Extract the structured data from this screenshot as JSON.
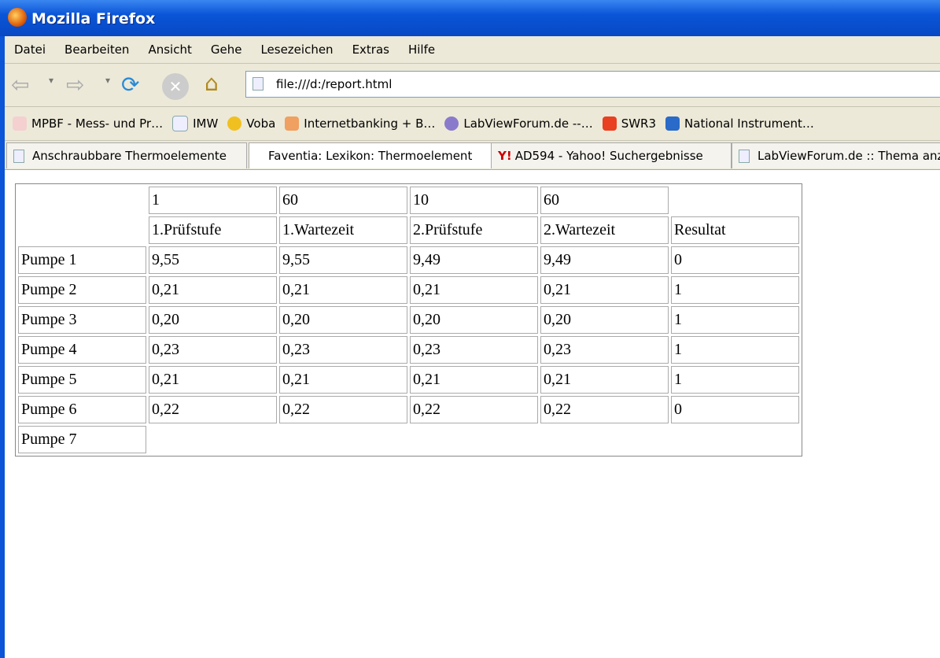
{
  "window": {
    "title": "Mozilla Firefox"
  },
  "menu": [
    "Datei",
    "Bearbeiten",
    "Ansicht",
    "Gehe",
    "Lesezeichen",
    "Extras",
    "Hilfe"
  ],
  "url": "file:///d:/report.html",
  "bookmarks": [
    "MPBF - Mess- und Pr…",
    "IMW",
    "Voba",
    "Internetbanking + B…",
    "LabViewForum.de --…",
    "SWR3",
    "National Instrument…"
  ],
  "tabs": [
    "Anschraubbare Thermoelemente",
    "Faventia: Lexikon: Thermoelement",
    "AD594 - Yahoo! Suchergebnisse",
    "LabViewForum.de :: Thema anz"
  ],
  "table": {
    "top_row": [
      "1",
      "60",
      "10",
      "60"
    ],
    "headers": [
      "1.Prüfstufe",
      "1.Wartezeit",
      "2.Prüfstufe",
      "2.Wartezeit",
      "Resultat"
    ],
    "rows": [
      {
        "name": "Pumpe 1",
        "values": [
          "9,55",
          "9,55",
          "9,49",
          "9,49",
          "0"
        ]
      },
      {
        "name": "Pumpe 2",
        "values": [
          "0,21",
          "0,21",
          "0,21",
          "0,21",
          "1"
        ]
      },
      {
        "name": "Pumpe 3",
        "values": [
          "0,20",
          "0,20",
          "0,20",
          "0,20",
          "1"
        ]
      },
      {
        "name": "Pumpe 4",
        "values": [
          "0,23",
          "0,23",
          "0,23",
          "0,23",
          "1"
        ]
      },
      {
        "name": "Pumpe 5",
        "values": [
          "0,21",
          "0,21",
          "0,21",
          "0,21",
          "1"
        ]
      },
      {
        "name": "Pumpe 6",
        "values": [
          "0,22",
          "0,22",
          "0,22",
          "0,22",
          "0"
        ]
      },
      {
        "name": "Pumpe 7",
        "values": []
      }
    ]
  }
}
